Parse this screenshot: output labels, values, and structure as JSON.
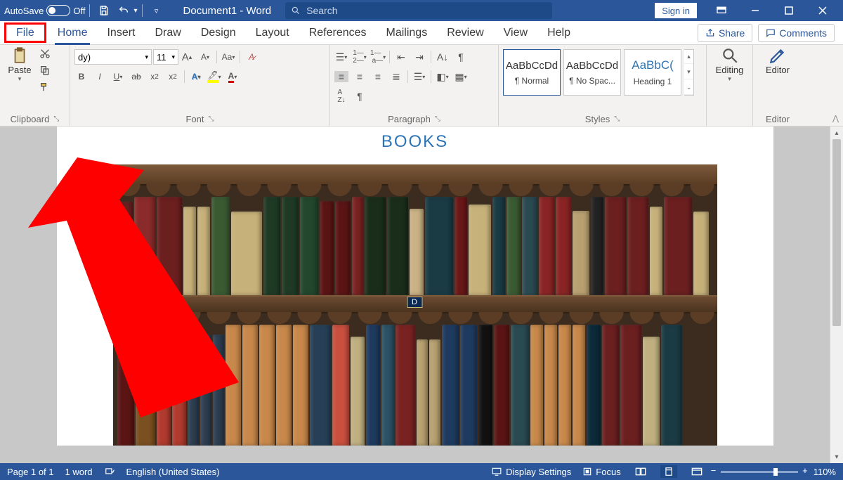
{
  "titlebar": {
    "autosave_label": "AutoSave",
    "autosave_state": "Off",
    "doc_title": "Document1 - Word",
    "search_placeholder": "Search",
    "signin_label": "Sign in"
  },
  "tabs": {
    "file": "File",
    "home": "Home",
    "insert": "Insert",
    "draw": "Draw",
    "design": "Design",
    "layout": "Layout",
    "references": "References",
    "mailings": "Mailings",
    "review": "Review",
    "view": "View",
    "help": "Help",
    "share": "Share",
    "comments": "Comments"
  },
  "ribbon": {
    "clipboard": {
      "paste": "Paste",
      "label": "Clipboard"
    },
    "font": {
      "size": "11",
      "label": "Font"
    },
    "paragraph": {
      "label": "Paragraph"
    },
    "styles": {
      "sample": "AaBbCcDd",
      "normal": "¶ Normal",
      "nospacing": "¶ No Spac...",
      "heading_sample": "AaBbC(",
      "heading1": "Heading 1",
      "label": "Styles"
    },
    "editing": {
      "label": "Editing"
    },
    "editor": {
      "label": "Editor",
      "btn": "Editor"
    }
  },
  "document": {
    "heading": "BOOKS",
    "shelf_marker": "D"
  },
  "statusbar": {
    "page": "Page 1 of 1",
    "words": "1 word",
    "language": "English (United States)",
    "display_settings": "Display Settings",
    "focus": "Focus",
    "zoom": "110%"
  }
}
